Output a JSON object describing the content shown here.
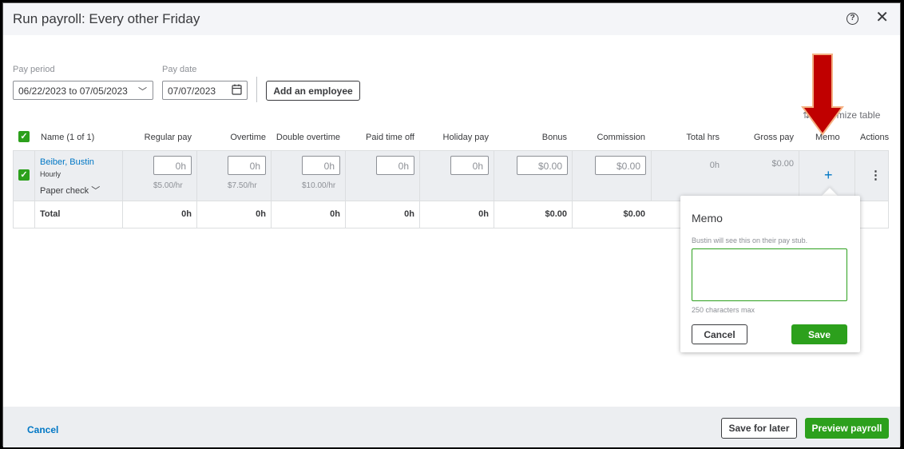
{
  "header": {
    "title": "Run payroll: Every other Friday"
  },
  "filters": {
    "pay_period_label": "Pay period",
    "pay_period_value": "06/22/2023 to 07/05/2023",
    "pay_date_label": "Pay date",
    "pay_date_value": "07/07/2023",
    "add_employee": "Add an employee",
    "customize_table": "omize table"
  },
  "table": {
    "headers": [
      "Name (1 of 1)",
      "Regular pay",
      "Overtime",
      "Double overtime",
      "Paid time off",
      "Holiday pay",
      "Bonus",
      "Commission",
      "Total hrs",
      "Gross pay",
      "Memo",
      "Actions"
    ],
    "employee": {
      "name": "Beiber, Bustin",
      "type": "Hourly",
      "payment_method": "Paper check",
      "regular_pay": "0h",
      "regular_rate": "$5.00/hr",
      "overtime": "0h",
      "overtime_rate": "$7.50/hr",
      "double_overtime": "0h",
      "double_overtime_rate": "$10.00/hr",
      "paid_time_off": "0h",
      "holiday_pay": "0h",
      "bonus": "$0.00",
      "commission": "$0.00",
      "total_hrs": "0h",
      "gross_pay": "$0.00",
      "memo_add": "+",
      "actions": "⋮"
    },
    "total": {
      "label": "Total",
      "regular_pay": "0h",
      "overtime": "0h",
      "double_overtime": "0h",
      "paid_time_off": "0h",
      "holiday_pay": "0h",
      "bonus": "$0.00",
      "commission": "$0.00"
    }
  },
  "memo_popup": {
    "title": "Memo",
    "hint": "Bustin will see this on their pay stub.",
    "text_value": "",
    "max_note": "250 characters max",
    "cancel": "Cancel",
    "save": "Save"
  },
  "footer": {
    "cancel": "Cancel",
    "save_for_later": "Save for later",
    "preview_payroll": "Preview payroll"
  },
  "colors": {
    "accent_green": "#2ca01c",
    "link_blue": "#0077c5",
    "annotation_arrow": "#c00000"
  },
  "icons": [
    "help-icon",
    "close-icon",
    "chevron-down-icon",
    "calendar-icon",
    "customize-icon",
    "checkmark-icon",
    "plus-icon",
    "kebab-icon",
    "annotation-arrow"
  ]
}
